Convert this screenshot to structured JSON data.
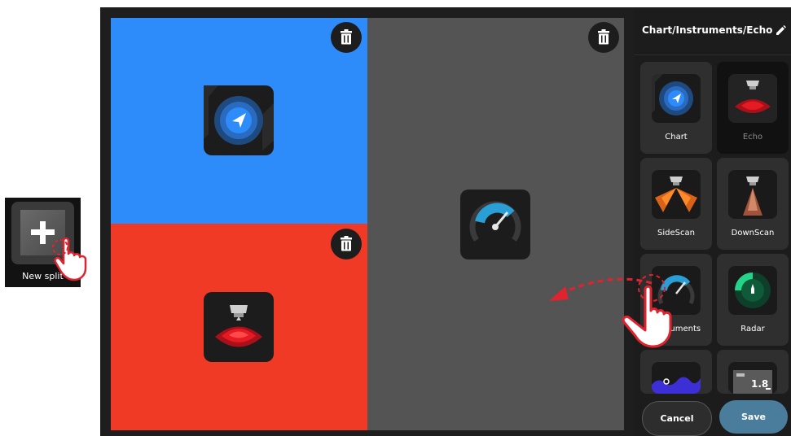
{
  "new_split": {
    "label": "New split"
  },
  "panel": {
    "title": "Chart/Instruments/Echo",
    "items": [
      {
        "label": "Chart",
        "selected": false
      },
      {
        "label": "Echo",
        "selected": true
      },
      {
        "label": "SideScan",
        "selected": false
      },
      {
        "label": "DownScan",
        "selected": false
      },
      {
        "label": "Instruments",
        "selected": false
      },
      {
        "label": "Radar",
        "selected": false
      },
      {
        "label": "",
        "selected": false
      },
      {
        "label": "",
        "selected": false
      }
    ],
    "tile_value": "1.8",
    "cancel_label": "Cancel",
    "save_label": "Save"
  },
  "panes": [
    {
      "app": "Chart",
      "color": "#2e8bfa"
    },
    {
      "app": "Echo",
      "color": "#f03a26"
    },
    {
      "app": "Instruments",
      "color": "#545454"
    }
  ],
  "colors": {
    "accent": "#4a7c9c",
    "gesture": "#e0232f"
  }
}
